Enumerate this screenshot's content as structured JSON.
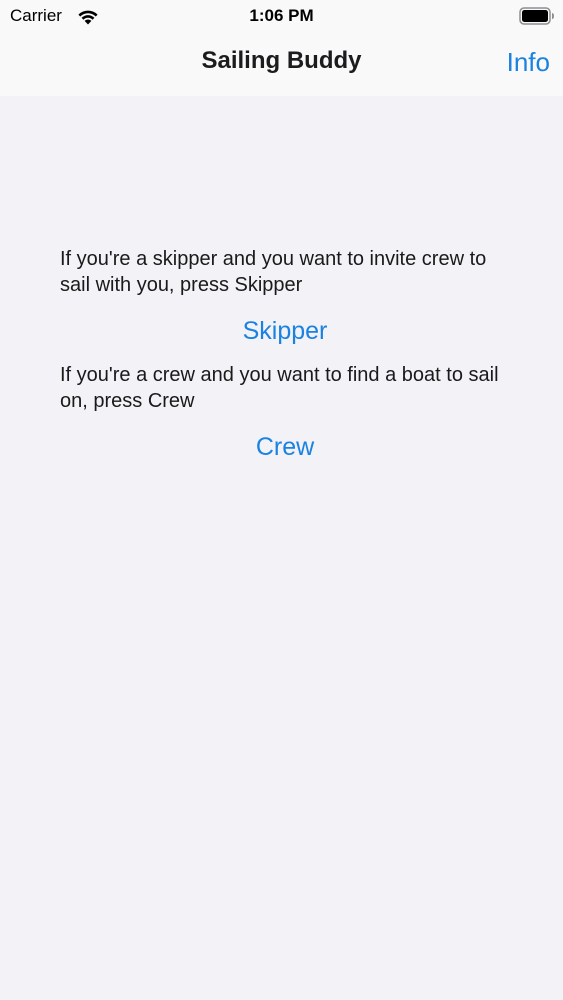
{
  "status_bar": {
    "carrier": "Carrier",
    "time": "1:06 PM"
  },
  "nav": {
    "title": "Sailing Buddy",
    "info_label": "Info"
  },
  "main": {
    "skipper_text": "If you're a skipper and you want to invite crew to sail with you, press Skipper",
    "skipper_button": "Skipper",
    "crew_text": "If you're a crew and you want to find a boat to sail on, press Crew",
    "crew_button": "Crew"
  },
  "colors": {
    "accent": "#1a82e0",
    "background": "#f2f2f7",
    "bar": "#f9f9f9"
  },
  "icons": {
    "wifi": "wifi-icon",
    "battery": "battery-icon"
  }
}
